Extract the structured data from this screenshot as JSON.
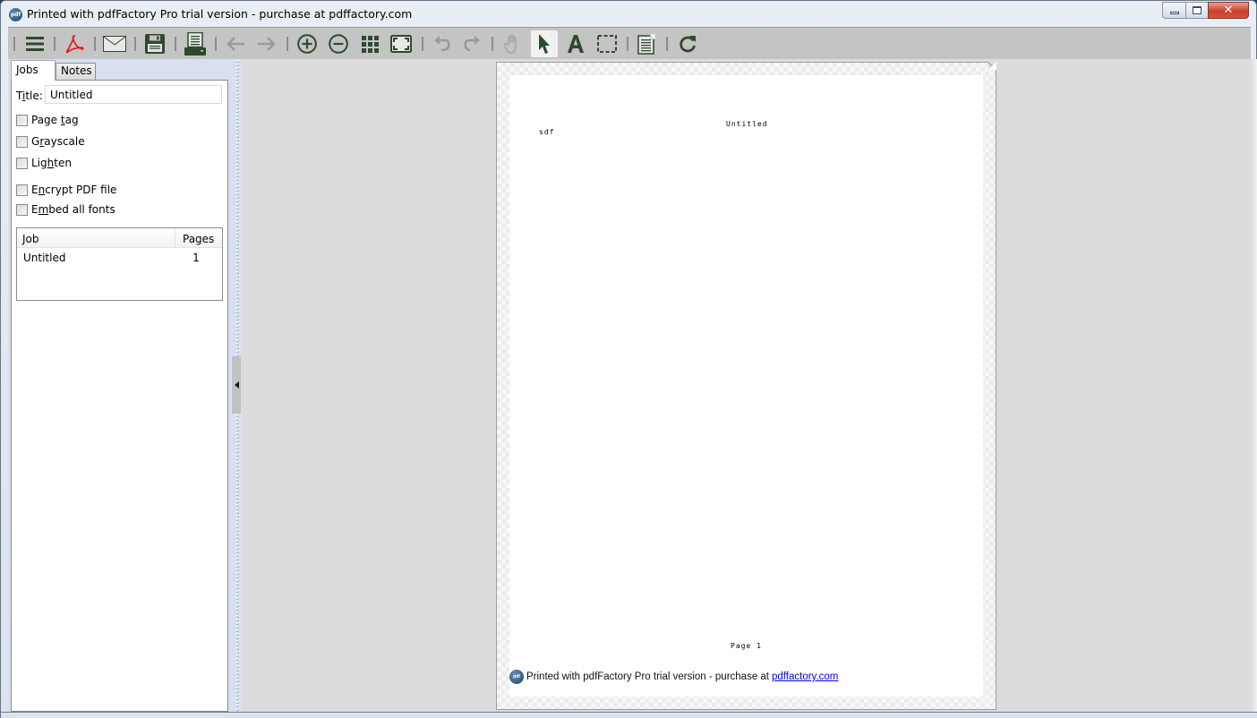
{
  "window": {
    "title": "Printed with pdfFactory Pro trial version - purchase at pdffactory.com",
    "app_icon": "pdffactory-logo-icon",
    "controls": {
      "minimize": "minimize-icon",
      "maximize": "restore-icon",
      "close": "✕"
    }
  },
  "toolbar": {
    "items": [
      {
        "name": "menu",
        "icon": "hamburger-menu-icon",
        "enabled": true
      },
      {
        "name": "save-pdf",
        "icon": "acrobat-pdf-icon",
        "enabled": true
      },
      {
        "name": "email",
        "icon": "envelope-icon",
        "enabled": true
      },
      {
        "name": "save",
        "icon": "floppy-disk-icon",
        "enabled": true
      },
      {
        "name": "print",
        "icon": "printer-icon",
        "enabled": true
      },
      {
        "name": "back",
        "icon": "arrow-left-icon",
        "enabled": false
      },
      {
        "name": "forward",
        "icon": "arrow-right-icon",
        "enabled": false
      },
      {
        "name": "zoom-in",
        "icon": "zoom-in-icon",
        "enabled": true
      },
      {
        "name": "zoom-out",
        "icon": "zoom-out-icon",
        "enabled": true
      },
      {
        "name": "thumbnails",
        "icon": "grid-icon",
        "enabled": true
      },
      {
        "name": "fit-page",
        "icon": "fit-screen-icon",
        "enabled": true
      },
      {
        "name": "undo",
        "icon": "undo-icon",
        "enabled": false
      },
      {
        "name": "redo",
        "icon": "redo-icon",
        "enabled": false
      },
      {
        "name": "hand",
        "icon": "hand-icon",
        "enabled": false
      },
      {
        "name": "select",
        "icon": "pointer-arrow-icon",
        "enabled": true,
        "active": true
      },
      {
        "name": "text",
        "icon": "text-tool-icon",
        "enabled": true
      },
      {
        "name": "marquee",
        "icon": "marquee-select-icon",
        "enabled": true
      },
      {
        "name": "delete-page",
        "icon": "delete-page-icon",
        "enabled": true
      },
      {
        "name": "refresh",
        "icon": "refresh-icon",
        "enabled": true
      }
    ],
    "colors": {
      "icon": "#2d4a2d",
      "disabled": "#9a9a9a",
      "pdf": "#e02020"
    }
  },
  "left_panel": {
    "tabs": [
      {
        "label": "Jobs",
        "active": true
      },
      {
        "label": "Notes",
        "active": false
      }
    ],
    "title_field": {
      "label_prefix": "T",
      "label_underlined": "i",
      "label_suffix": "tle:",
      "value": "Untitled"
    },
    "options": [
      {
        "pre": "Page ",
        "u": "t",
        "post": "ag",
        "checked": false
      },
      {
        "pre": "G",
        "u": "r",
        "post": "ayscale",
        "checked": false
      },
      {
        "pre": "Lig",
        "u": "h",
        "post": "ten",
        "checked": false
      },
      {
        "pre": "E",
        "u": "n",
        "post": "crypt PDF file",
        "checked": false
      },
      {
        "pre": "E",
        "u": "m",
        "post": "bed all fonts",
        "checked": false
      }
    ],
    "job_table": {
      "headers": [
        "Job",
        "Pages"
      ],
      "rows": [
        {
          "job": "Untitled",
          "pages": "1"
        }
      ]
    }
  },
  "document": {
    "header_title": "Untitled",
    "body_text": "sdf",
    "footer_text": "Page  1",
    "watermark": {
      "text": "Printed with pdfFactory Pro trial version - purchase at",
      "link": "pdffactory.com"
    }
  }
}
